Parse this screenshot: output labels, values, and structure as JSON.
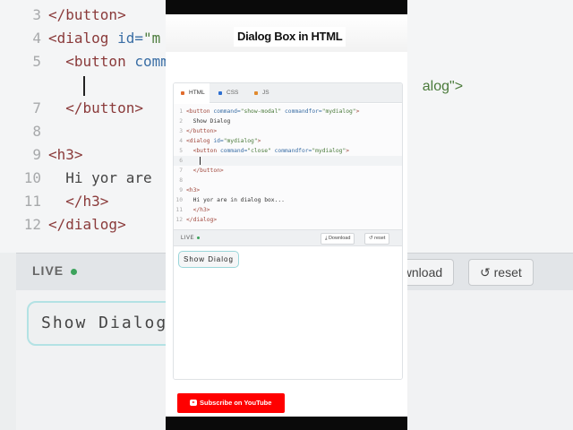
{
  "background": {
    "lines": [
      {
        "num": "3",
        "parts": [
          {
            "t": "tag",
            "v": "</button>"
          }
        ]
      },
      {
        "num": "4",
        "parts": [
          {
            "t": "tag",
            "v": "<dialog "
          },
          {
            "t": "attr",
            "v": "id="
          },
          {
            "t": "val",
            "v": "\"m"
          }
        ]
      },
      {
        "num": "5",
        "parts": [
          {
            "t": "text",
            "v": "  "
          },
          {
            "t": "tag",
            "v": "<button "
          },
          {
            "t": "attr",
            "v": "comm"
          }
        ]
      },
      {
        "num": "",
        "cursor": true,
        "parts": [
          {
            "t": "text",
            "v": "    "
          }
        ]
      },
      {
        "num": "7",
        "parts": [
          {
            "t": "text",
            "v": "  "
          },
          {
            "t": "tag",
            "v": "</button>"
          }
        ]
      },
      {
        "num": "8",
        "parts": []
      },
      {
        "num": "9",
        "parts": [
          {
            "t": "tag",
            "v": "<h3>"
          }
        ]
      },
      {
        "num": "10",
        "parts": [
          {
            "t": "text",
            "v": "  Hi yor are"
          }
        ]
      },
      {
        "num": "11",
        "parts": [
          {
            "t": "text",
            "v": "  "
          },
          {
            "t": "tag",
            "v": "</h3>"
          }
        ]
      },
      {
        "num": "12",
        "parts": [
          {
            "t": "tag",
            "v": "</dialog>"
          }
        ]
      }
    ],
    "right_fragment": "alog\">",
    "live_label": "LIVE",
    "download_fragment": "ownload",
    "reset_label": "↺ reset",
    "show_fragment": "Show Dialog"
  },
  "header": {
    "title": "Dialog Box in HTML"
  },
  "editor": {
    "tabs": [
      {
        "label": "HTML",
        "color": "#e06c2e",
        "active": true
      },
      {
        "label": "CSS",
        "color": "#2d6fd1",
        "active": false
      },
      {
        "label": "JS",
        "color": "#e08a2e",
        "active": false
      }
    ],
    "lines": [
      {
        "num": "1",
        "parts": [
          {
            "t": "tag",
            "v": "<button "
          },
          {
            "t": "attr",
            "v": "command="
          },
          {
            "t": "val",
            "v": "\"show-modal\" "
          },
          {
            "t": "attr",
            "v": "commandfor="
          },
          {
            "t": "val",
            "v": "\"mydialog\""
          },
          {
            "t": "tag",
            "v": ">"
          }
        ]
      },
      {
        "num": "2",
        "parts": [
          {
            "t": "text",
            "v": "  Show Dialog"
          }
        ]
      },
      {
        "num": "3",
        "parts": [
          {
            "t": "tag",
            "v": "</button>"
          }
        ]
      },
      {
        "num": "4",
        "parts": [
          {
            "t": "tag",
            "v": "<dialog "
          },
          {
            "t": "attr",
            "v": "id="
          },
          {
            "t": "val",
            "v": "\"mydialog\""
          },
          {
            "t": "tag",
            "v": ">"
          }
        ]
      },
      {
        "num": "5",
        "parts": [
          {
            "t": "text",
            "v": "  "
          },
          {
            "t": "tag",
            "v": "<button "
          },
          {
            "t": "attr",
            "v": "command="
          },
          {
            "t": "val",
            "v": "\"close\" "
          },
          {
            "t": "attr",
            "v": "commandfor="
          },
          {
            "t": "val",
            "v": "\"mydialog\""
          },
          {
            "t": "tag",
            "v": ">"
          }
        ]
      },
      {
        "num": "6",
        "cursor": true,
        "active": true,
        "parts": [
          {
            "t": "text",
            "v": "    "
          }
        ]
      },
      {
        "num": "7",
        "parts": [
          {
            "t": "text",
            "v": "  "
          },
          {
            "t": "tag",
            "v": "</button>"
          }
        ]
      },
      {
        "num": "8",
        "parts": []
      },
      {
        "num": "9",
        "parts": [
          {
            "t": "tag",
            "v": "<h3>"
          }
        ]
      },
      {
        "num": "10",
        "parts": [
          {
            "t": "text",
            "v": "  Hi yor are in dialog box..."
          }
        ]
      },
      {
        "num": "11",
        "parts": [
          {
            "t": "text",
            "v": "  "
          },
          {
            "t": "tag",
            "v": "</h3>"
          }
        ]
      },
      {
        "num": "12",
        "parts": [
          {
            "t": "tag",
            "v": "</dialog>"
          }
        ]
      }
    ],
    "live_label": "LIVE",
    "download_label": "⤓ Download",
    "reset_label": "↺ reset"
  },
  "preview": {
    "show_button_label": "Show Dialog"
  },
  "footer": {
    "youtube_label": "Subscribe on YouTube"
  },
  "colors": {
    "youtube": "#ff0000",
    "live_dot": "#3ca35c",
    "show_border": "#9ad6da"
  }
}
